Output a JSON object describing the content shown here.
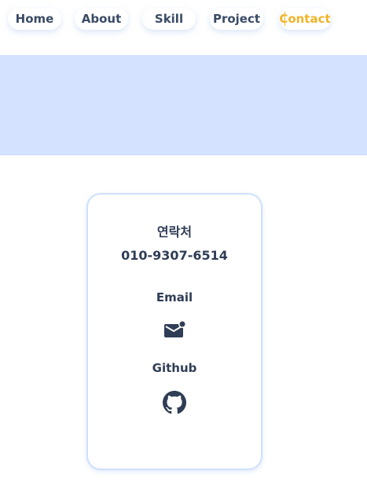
{
  "nav": {
    "items": [
      {
        "label": "Home"
      },
      {
        "label": "About"
      },
      {
        "label": "Skill"
      },
      {
        "label": "Project"
      },
      {
        "label": "Contact"
      }
    ],
    "active": "Contact"
  },
  "colors": {
    "accent": "#f0b429",
    "banner": "#d4e2ff",
    "text": "#3a4b66",
    "card_border": "#cfe0fb"
  },
  "contact": {
    "title": "연락처",
    "phone": "010-9307-6514",
    "email_label": "Email",
    "email_icon": "mail-icon",
    "github_label": "Github",
    "github_icon": "github-icon"
  }
}
